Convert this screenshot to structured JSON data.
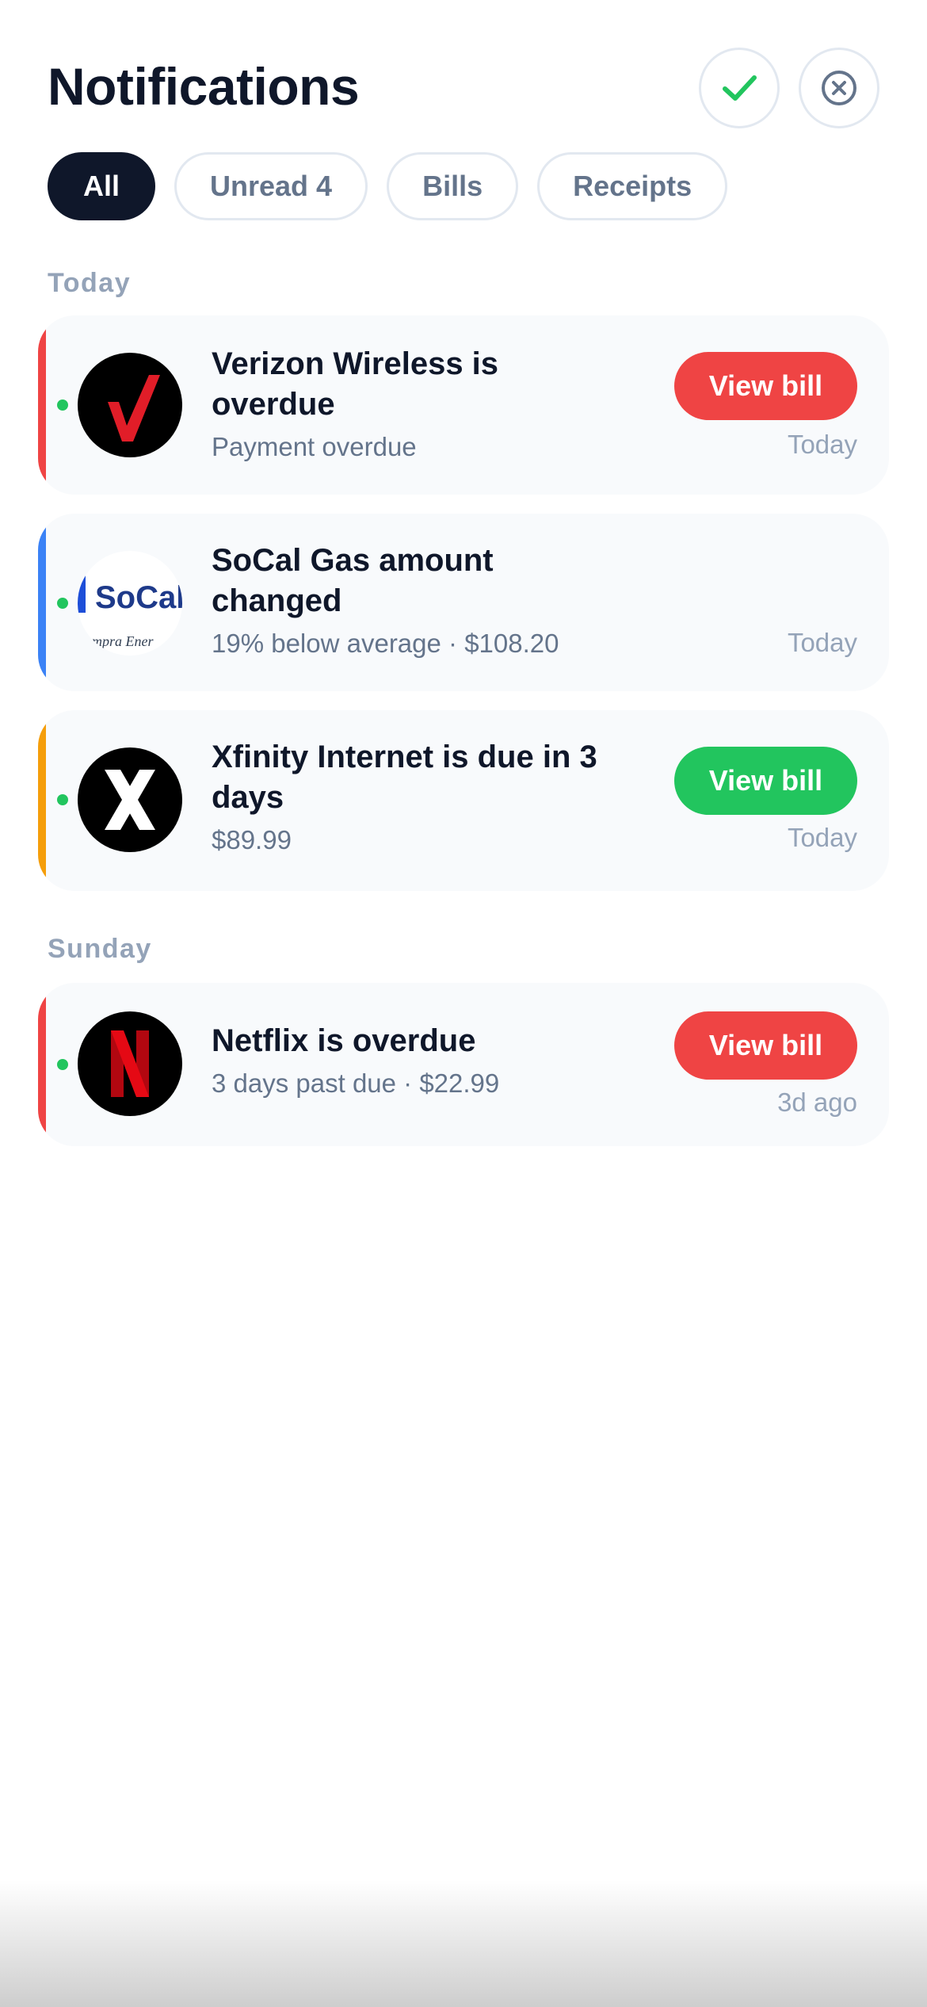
{
  "header": {
    "title": "Notifications",
    "mark_read_icon": "check-icon",
    "dismiss_icon": "close-circle-icon"
  },
  "filters": {
    "all": "All",
    "unread": "Unread 4",
    "bills": "Bills",
    "receipts": "Receipts",
    "selected": "All"
  },
  "sections": {
    "today": "Today",
    "sunday": "Sunday"
  },
  "notifications": [
    {
      "title": "Verizon Wireless is overdue",
      "subtitle": "Payment overdue",
      "action": "View bill",
      "time": "Today",
      "accent_color": "#ef4444",
      "action_color": "#ef4444",
      "unread": true,
      "logo": "verizon-logo-icon"
    },
    {
      "title": "SoCal Gas amount changed",
      "subtitle": "19% below average · $108.20",
      "time": "Today",
      "accent_color": "#3b82f6",
      "unread": true,
      "logo": "socalgas-logo-icon",
      "logo_text": "SoCalG",
      "logo_subtext": "empra Ener"
    },
    {
      "title": "Xfinity Internet is due in 3 days",
      "subtitle": "$89.99",
      "action": "View bill",
      "time": "Today",
      "accent_color": "#f59e0b",
      "action_color": "#22c55e",
      "unread": true,
      "logo": "xfinity-logo-icon"
    },
    {
      "title": "Netflix is overdue",
      "subtitle": "3 days past due · $22.99",
      "action": "View bill",
      "time": "3d ago",
      "accent_color": "#ef4444",
      "action_color": "#ef4444",
      "unread": true,
      "logo": "netflix-logo-icon"
    }
  ],
  "colors": {
    "primary_text": "#0f172a",
    "muted_text": "#64748b",
    "faint_text": "#94a3b8",
    "card_bg": "#f8fafc",
    "unread_dot": "#22c55e",
    "border": "#e2e8f0"
  }
}
